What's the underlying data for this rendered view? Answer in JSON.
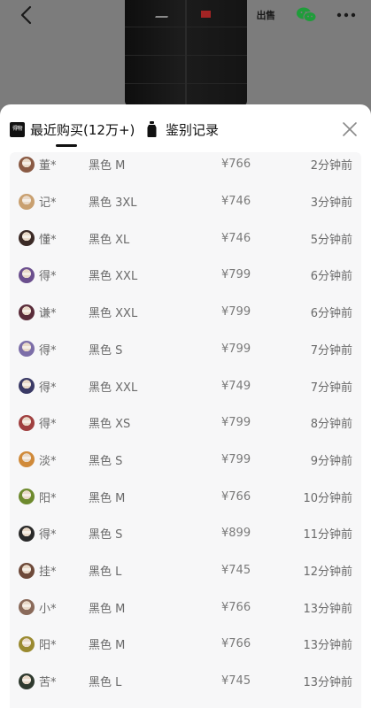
{
  "header": {
    "trade_label": "出售"
  },
  "tabs": [
    {
      "label": "最近购买(12万+)",
      "icon_text": "得物",
      "active": true
    },
    {
      "label": "鉴别记录",
      "active": false
    }
  ],
  "colors": {
    "avatar_palette": [
      "#8a5a44",
      "#c9a070",
      "#3b2a26",
      "#6b4f8e",
      "#5a2c3a",
      "#7c6ea8",
      "#3a3a66",
      "#a04040",
      "#d08a3a",
      "#6e8a2e",
      "#2a2a2a",
      "#6e4a3a",
      "#8a6a5a",
      "#9a8a30",
      "#2f3a2f"
    ]
  },
  "purchases": [
    {
      "name": "董*",
      "spec": "黑色 M",
      "price": "¥766",
      "time": "2分钟前"
    },
    {
      "name": "记*",
      "spec": "黑色 3XL",
      "price": "¥746",
      "time": "3分钟前"
    },
    {
      "name": "懂*",
      "spec": "黑色 XL",
      "price": "¥746",
      "time": "5分钟前"
    },
    {
      "name": "得*",
      "spec": "黑色 XXL",
      "price": "¥799",
      "time": "6分钟前"
    },
    {
      "name": "谦*",
      "spec": "黑色 XXL",
      "price": "¥799",
      "time": "6分钟前"
    },
    {
      "name": "得*",
      "spec": "黑色 S",
      "price": "¥799",
      "time": "7分钟前"
    },
    {
      "name": "得*",
      "spec": "黑色 XXL",
      "price": "¥749",
      "time": "7分钟前"
    },
    {
      "name": "得*",
      "spec": "黑色 XS",
      "price": "¥799",
      "time": "8分钟前"
    },
    {
      "name": "淡*",
      "spec": "黑色 S",
      "price": "¥799",
      "time": "9分钟前"
    },
    {
      "name": "阳*",
      "spec": "黑色 M",
      "price": "¥766",
      "time": "10分钟前"
    },
    {
      "name": "得*",
      "spec": "黑色 S",
      "price": "¥899",
      "time": "11分钟前"
    },
    {
      "name": "挂*",
      "spec": "黑色 L",
      "price": "¥745",
      "time": "12分钟前"
    },
    {
      "name": "小*",
      "spec": "黑色 M",
      "price": "¥766",
      "time": "13分钟前"
    },
    {
      "name": "阳*",
      "spec": "黑色 M",
      "price": "¥766",
      "time": "13分钟前"
    },
    {
      "name": "苦*",
      "spec": "黑色 L",
      "price": "¥745",
      "time": "13分钟前"
    }
  ]
}
